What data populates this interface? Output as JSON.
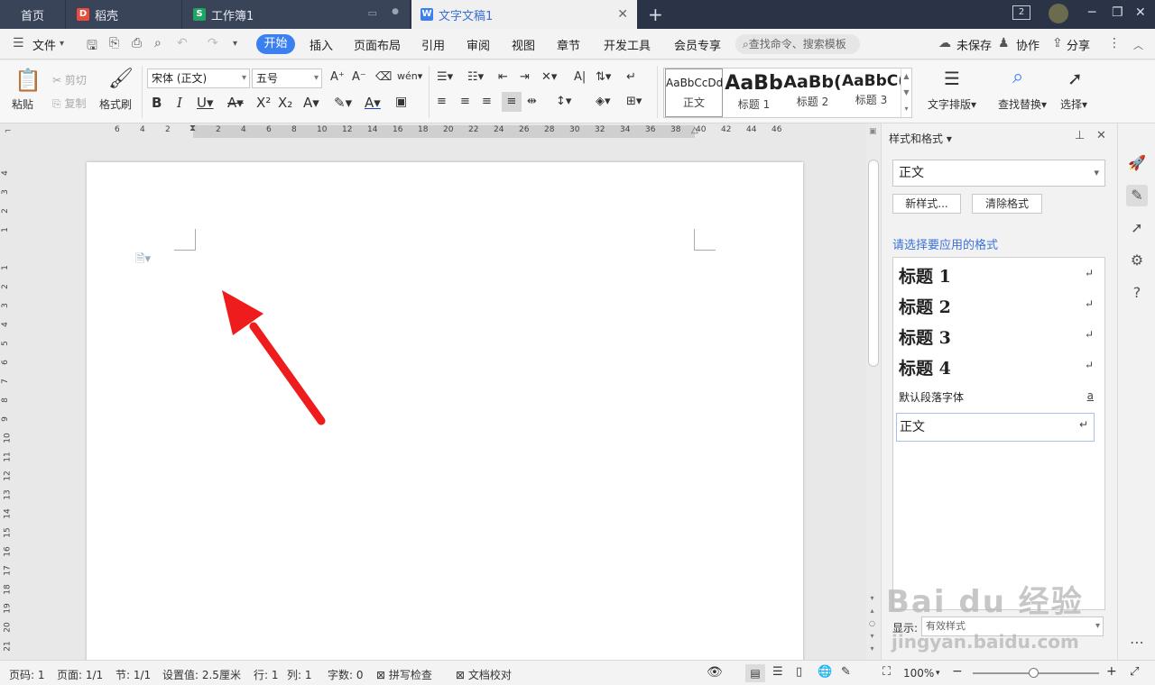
{
  "tabs": {
    "home": "首页",
    "daoke": "稻壳",
    "workbook": "工作簿1",
    "document": "文字文稿1",
    "new_tab": "+",
    "badge_count": "2"
  },
  "menu": {
    "file": "文件",
    "items": [
      "开始",
      "插入",
      "页面布局",
      "引用",
      "审阅",
      "视图",
      "章节",
      "开发工具",
      "会员专享"
    ],
    "search_placeholder": "查找命令、搜索模板",
    "unsaved": "未保存",
    "collaborate": "协作",
    "share": "分享"
  },
  "ribbon": {
    "paste": "粘贴",
    "cut": "剪切",
    "copy": "复制",
    "format_painter": "格式刷",
    "font_name": "宋体 (正文)",
    "font_size": "五号",
    "styles": [
      {
        "preview": "AaBbCcDd",
        "name": "正文"
      },
      {
        "preview": "AaBb",
        "name": "标题 1"
      },
      {
        "preview": "AaBb(",
        "name": "标题 2"
      },
      {
        "preview": "AaBbC(",
        "name": "标题 3"
      }
    ],
    "text_layout": "文字排版",
    "find_replace": "查找替换",
    "select": "选择"
  },
  "ruler": {
    "h_left": [
      "6",
      "4",
      "2"
    ],
    "h_right": [
      "2",
      "4",
      "6",
      "8",
      "10",
      "12",
      "14",
      "16",
      "18",
      "20",
      "22",
      "24",
      "26",
      "28",
      "30",
      "32",
      "34",
      "36",
      "38",
      "40",
      "42",
      "44",
      "46"
    ],
    "v_top": [
      "4",
      "3",
      "2",
      "1"
    ],
    "v_body": [
      "1",
      "2",
      "3",
      "4",
      "5",
      "6",
      "7",
      "8",
      "9",
      "10",
      "11",
      "12",
      "13",
      "14",
      "15",
      "16",
      "17",
      "18",
      "19",
      "20",
      "21"
    ]
  },
  "pane": {
    "title": "样式和格式",
    "current_style": "正文",
    "new_style": "新样式...",
    "clear_format": "清除格式",
    "hint": "请选择要应用的格式",
    "styles": [
      {
        "label": "标题  1",
        "mark": "↵"
      },
      {
        "label": "标题  2",
        "mark": "↵"
      },
      {
        "label": "标题  3",
        "mark": "↵"
      },
      {
        "label": "标题  4",
        "mark": "↵"
      },
      {
        "label": "默认段落字体",
        "mark": "a"
      },
      {
        "label": "正文",
        "mark": "↵"
      }
    ],
    "show_label": "显示:",
    "show_value": "有效样式"
  },
  "status": {
    "page_no": "页码: 1",
    "pages": "页面: 1/1",
    "section": "节: 1/1",
    "setting": "设置值: 2.5厘米",
    "row": "行: 1",
    "col": "列: 1",
    "words": "字数: 0",
    "spell": "拼写检查",
    "proof": "文档校对",
    "zoom": "100%"
  },
  "watermark": {
    "logo": "Bai du 经验",
    "url": "jingyan.baidu.com"
  },
  "colors": {
    "tabbar": "#2b3346",
    "accent": "#3b7ff1",
    "arrow": "#ee1c1c"
  }
}
